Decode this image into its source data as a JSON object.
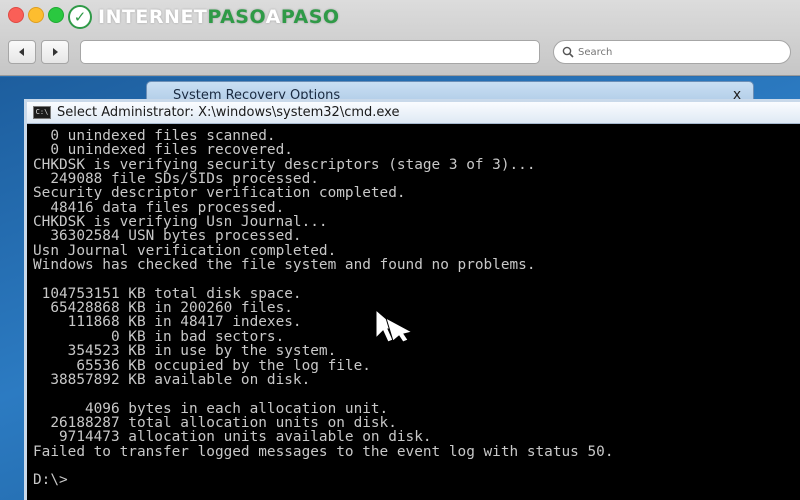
{
  "browser": {
    "brand": {
      "part1": "INTERNET",
      "part2": "PASO",
      "part3": "A",
      "part4": "PASO"
    },
    "search_placeholder": "Search",
    "url": ""
  },
  "recovery_window": {
    "title": "System Recovery Options",
    "close_label": "x"
  },
  "cmd": {
    "icon_label": "C:\\",
    "title": "Select Administrator: X:\\windows\\system32\\cmd.exe",
    "lines": [
      "  0 unindexed files scanned.",
      "  0 unindexed files recovered.",
      "CHKDSK is verifying security descriptors (stage 3 of 3)...",
      "  249088 file SDs/SIDs processed.",
      "Security descriptor verification completed.",
      "  48416 data files processed.",
      "CHKDSK is verifying Usn Journal...",
      "  36302584 USN bytes processed.",
      "Usn Journal verification completed.",
      "Windows has checked the file system and found no problems.",
      "",
      " 104753151 KB total disk space.",
      "  65428868 KB in 200260 files.",
      "    111868 KB in 48417 indexes.",
      "         0 KB in bad sectors.",
      "    354523 KB in use by the system.",
      "     65536 KB occupied by the log file.",
      "  38857892 KB available on disk.",
      "",
      "      4096 bytes in each allocation unit.",
      "  26188287 total allocation units on disk.",
      "   9714473 allocation units available on disk.",
      "Failed to transfer logged messages to the event log with status 50.",
      "",
      "D:\\>"
    ]
  }
}
